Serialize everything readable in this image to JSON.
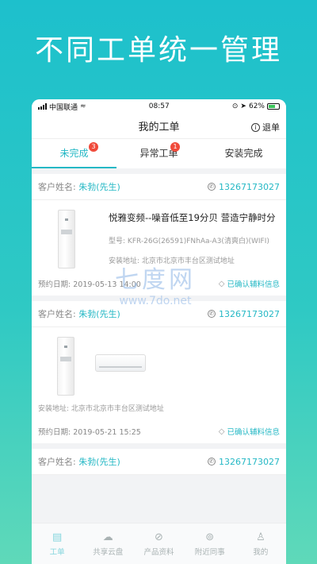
{
  "banner": "不同工单统一管理",
  "status": {
    "carrier": "中国联通",
    "time": "08:57",
    "battery": "62%"
  },
  "nav": {
    "title": "我的工单",
    "logout": "退单"
  },
  "tabs": [
    {
      "label": "未完成",
      "badge": "3"
    },
    {
      "label": "异常工单",
      "badge": "1"
    },
    {
      "label": "安装完成"
    }
  ],
  "cards": [
    {
      "customer_label": "客户姓名:",
      "customer_name": "朱勃(先生)",
      "phone": "13267173027",
      "product_title": "悦雅变频--噪音低至19分贝 营造宁静时分",
      "model_label": "型号:",
      "model": "KFR-26G(26591)FNhAa-A3(清爽白)(WIFI)",
      "address_label": "安装地址:",
      "address": "北京市北京市丰台区测试地址",
      "date_label": "预约日期:",
      "date": "2019-05-13 14:00",
      "confirm": "已确认辅料信息"
    },
    {
      "customer_label": "客户姓名:",
      "customer_name": "朱勃(先生)",
      "phone": "13267173027",
      "address_label": "安装地址:",
      "address": "北京市北京市丰台区测试地址",
      "date_label": "预约日期:",
      "date": "2019-05-21 15:25",
      "confirm": "已确认辅料信息"
    },
    {
      "customer_label": "客户姓名:",
      "customer_name": "朱勃(先生)",
      "phone": "13267173027"
    }
  ],
  "tabbar": [
    {
      "label": "工单",
      "icon": "document-icon"
    },
    {
      "label": "共享云盘",
      "icon": "cloud-icon"
    },
    {
      "label": "产品资料",
      "icon": "compass-icon"
    },
    {
      "label": "附近同事",
      "icon": "location-icon"
    },
    {
      "label": "我的",
      "icon": "user-icon"
    }
  ],
  "watermark": {
    "big": "七度网",
    "small": "www.7do.net"
  },
  "colors": {
    "accent": "#25b8c5",
    "badge": "#f04a3a"
  }
}
